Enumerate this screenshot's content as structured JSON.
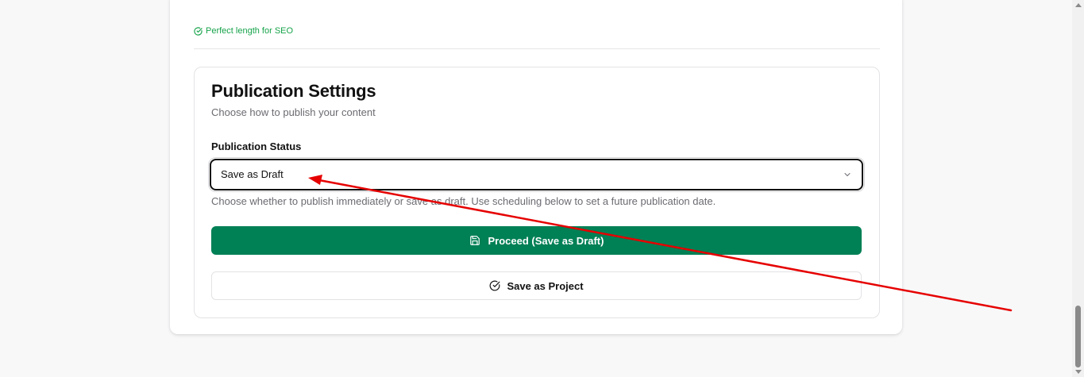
{
  "seo_note": {
    "text": "Perfect length for SEO",
    "icon": "check-circle-icon",
    "color": "#16a34a"
  },
  "publication_settings": {
    "title": "Publication Settings",
    "subtitle": "Choose how to publish your content",
    "status_label": "Publication Status",
    "status_value": "Save as Draft",
    "status_helper": "Choose whether to publish immediately or save as draft. Use scheduling below to set a future publication date.",
    "primary_button": {
      "label": "Proceed (Save as Draft)",
      "icon": "save-icon",
      "color": "#008055"
    },
    "secondary_button": {
      "label": "Save as Project",
      "icon": "check-circle-icon"
    }
  },
  "annotation": {
    "type": "arrow",
    "color": "#e60000"
  }
}
